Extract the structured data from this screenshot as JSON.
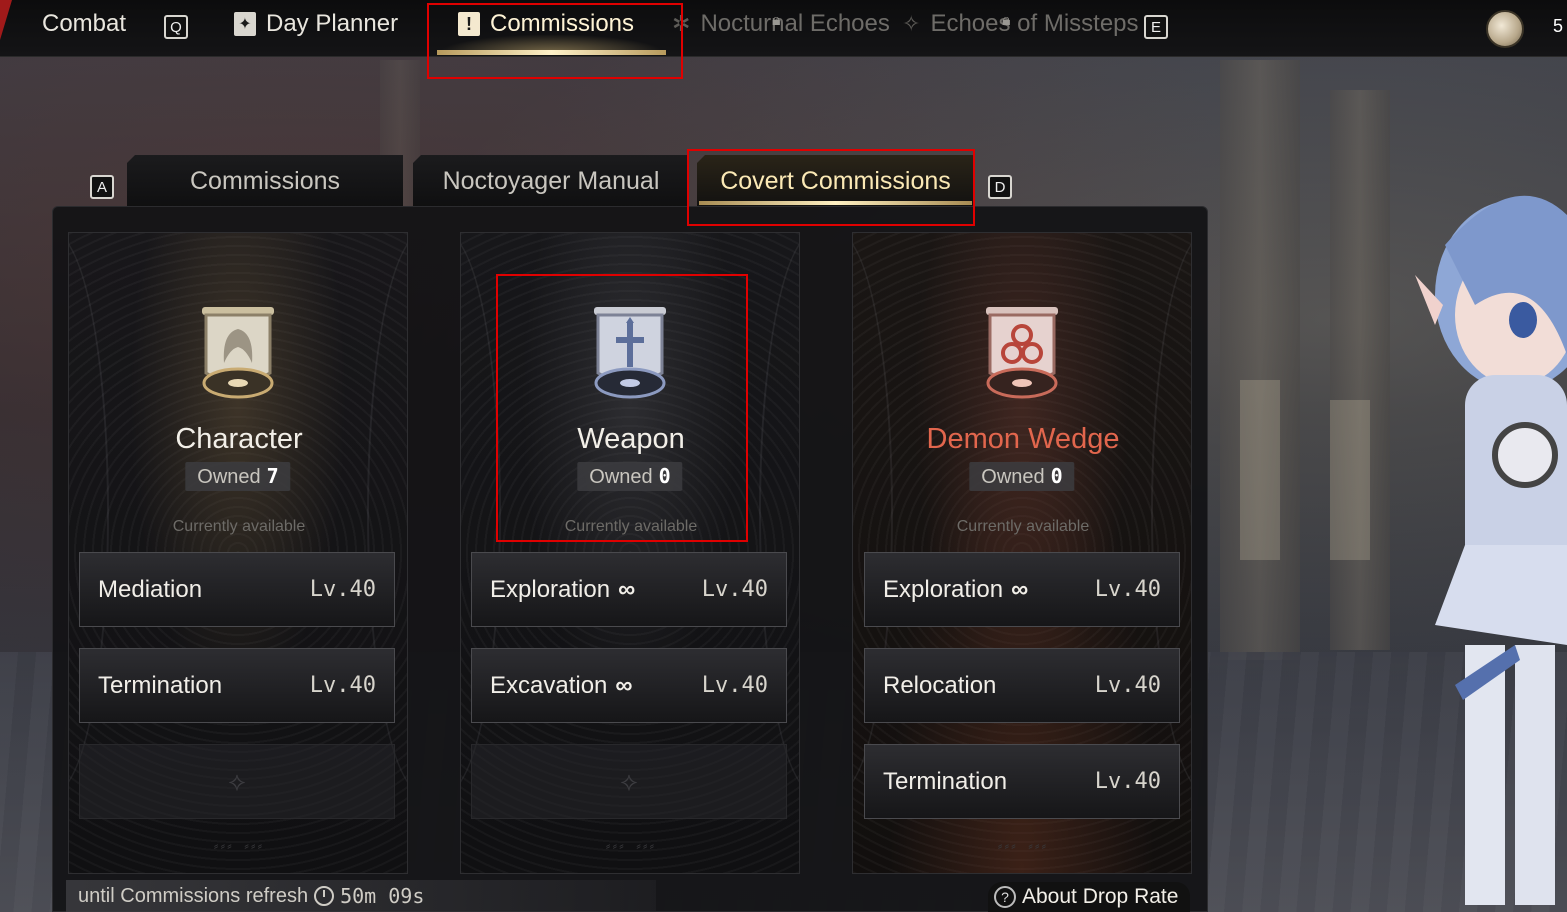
{
  "topnav": {
    "items": [
      {
        "label": "Combat",
        "key": "Q"
      },
      {
        "label": "Day Planner"
      },
      {
        "label": "Commissions",
        "active": true
      },
      {
        "label": "Nocturnal Echoes",
        "locked": true
      },
      {
        "label": "Echoes of Missteps",
        "locked": true,
        "key": "E"
      }
    ],
    "currency_count": "5"
  },
  "subtabs": {
    "left_key": "A",
    "right_key": "D",
    "items": [
      {
        "label": "Commissions"
      },
      {
        "label": "Noctoyager Manual"
      },
      {
        "label": "Covert Commissions",
        "active": true
      }
    ]
  },
  "cards": [
    {
      "title": "Character",
      "owned_label": "Owned",
      "owned_count": "7",
      "availability": "Currently available",
      "accent": "#e9d9b5",
      "commissions": [
        {
          "name": "Mediation",
          "level": "Lv.40",
          "infinite": false
        },
        {
          "name": "Termination",
          "level": "Lv.40",
          "infinite": false
        }
      ]
    },
    {
      "title": "Weapon",
      "owned_label": "Owned",
      "owned_count": "0",
      "availability": "Currently available",
      "accent": "#aab4d6",
      "commissions": [
        {
          "name": "Exploration",
          "level": "Lv.40",
          "infinite": true
        },
        {
          "name": "Excavation",
          "level": "Lv.40",
          "infinite": true
        }
      ]
    },
    {
      "title": "Demon Wedge",
      "owned_label": "Owned",
      "owned_count": "0",
      "availability": "Currently available",
      "accent": "#e2664d",
      "commissions": [
        {
          "name": "Exploration",
          "level": "Lv.40",
          "infinite": true
        },
        {
          "name": "Relocation",
          "level": "Lv.40",
          "infinite": false
        },
        {
          "name": "Termination",
          "level": "Lv.40",
          "infinite": false
        }
      ]
    }
  ],
  "infinity_symbol": "∞",
  "footer": {
    "refresh_text": "until Commissions refresh",
    "timer": "50m 09s",
    "drop_rate": "About Drop Rate"
  },
  "colors": {
    "highlight": "#e00000",
    "gold": "#fbe9b5"
  }
}
